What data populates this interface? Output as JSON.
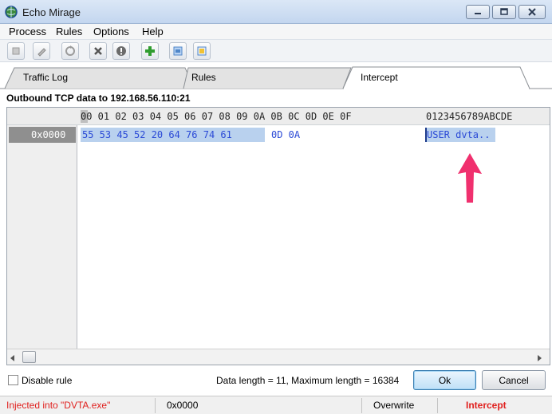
{
  "window": {
    "title": "Echo Mirage",
    "icons": {
      "app": "globe-icon",
      "minimize": "minimize-icon",
      "maximize": "maximize-icon",
      "close": "close-icon"
    }
  },
  "menu": [
    "Process",
    "Rules",
    "Options",
    "Help"
  ],
  "toolbar": {
    "buttons": [
      "stop-icon",
      "pencil-icon",
      "refresh-icon",
      "cross-icon",
      "alert-icon",
      "add-icon",
      "blue-page-icon",
      "yellow-page-icon"
    ]
  },
  "tabs": {
    "traffic_log": "Traffic Log",
    "rules": "Rules",
    "intercept": "Intercept",
    "active": "Intercept"
  },
  "intercept": {
    "header": "Outbound TCP data to 192.168.56.110:21",
    "columns_hex": "00 01 02 03 04 05 06 07 08 09 0A 0B 0C 0D 0E 0F",
    "columns_ascii": "0123456789ABCDE",
    "row": {
      "offset": "0x0000",
      "hex_selected": "55 53 45 52 20 64 76 74 61",
      "hex_rest": "0D 0A",
      "ascii": "USER dvta.."
    },
    "annotation": {
      "icon": "arrow-up-icon",
      "color": "#f0306e"
    }
  },
  "footer": {
    "disable_rule_label": "Disable rule",
    "disable_rule_checked": false,
    "data_length_text": "Data length = 11, Maximum length = 16384",
    "ok_label": "Ok",
    "cancel_label": "Cancel"
  },
  "status": {
    "injected": "Injected into \"DVTA.exe\"",
    "offset": "0x0000",
    "mode": "Overwrite",
    "state": "Intercept",
    "colors": {
      "alert": "#e0201e"
    }
  }
}
